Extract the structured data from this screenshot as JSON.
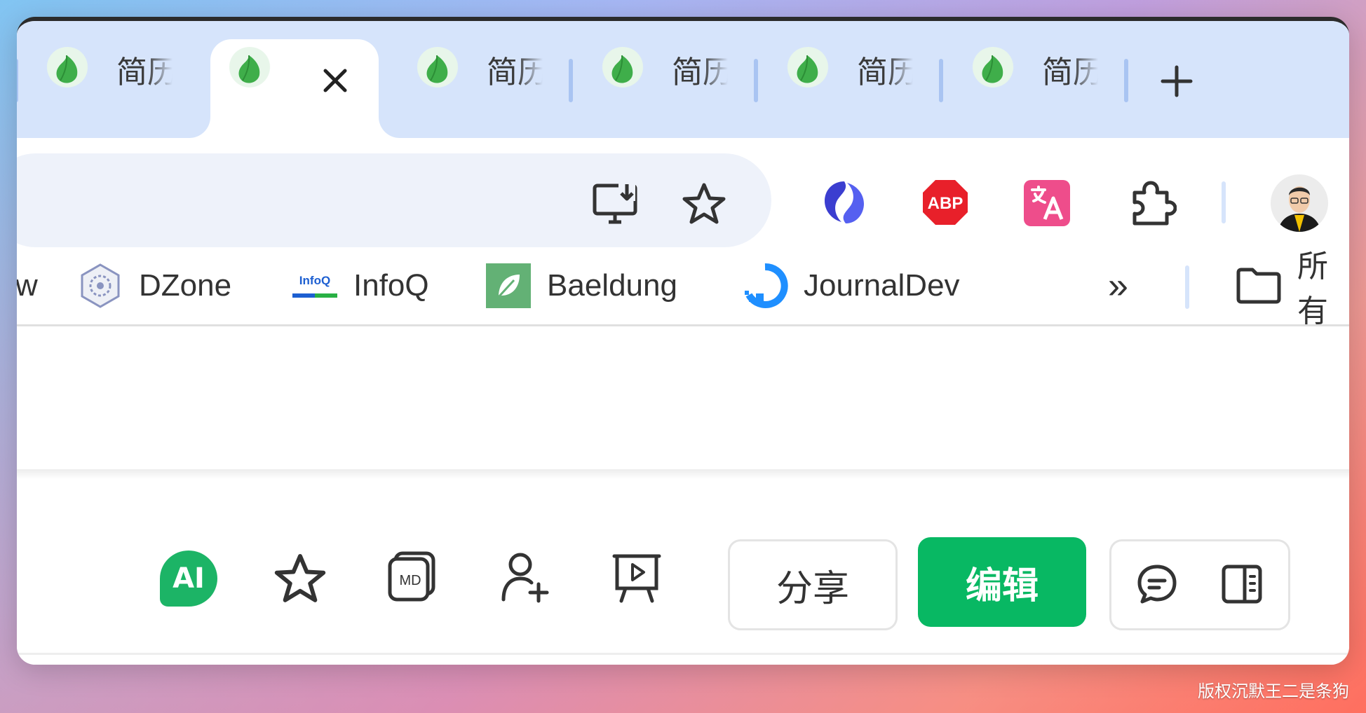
{
  "tabs": [
    {
      "title": "简历"
    },
    {
      "title": ""
    },
    {
      "title": "简历"
    },
    {
      "title": "简历"
    },
    {
      "title": "简历"
    },
    {
      "title": "简历"
    }
  ],
  "active_tab": {
    "close_icon": "close-icon"
  },
  "toolbar": {
    "icons": [
      "install-app-icon",
      "star-icon",
      "sider-extension-icon",
      "adblock-plus-icon",
      "translate-extension-icon",
      "extensions-puzzle-icon",
      "profile-avatar"
    ],
    "abp_text": "ABP"
  },
  "bookmarks": [
    {
      "label": "w"
    },
    {
      "label": "DZone"
    },
    {
      "label": "InfoQ",
      "logo_text": "InfoQ"
    },
    {
      "label": "Baeldung"
    },
    {
      "label": "JournalDev"
    }
  ],
  "bookmarks_more": "»",
  "bookmarks_folder": "所有",
  "bottom": {
    "ai_label": "AI",
    "md_label": "MD",
    "share_label": "分享",
    "edit_label": "编辑"
  },
  "watermark": "版权沉默王二是条狗",
  "colors": {
    "accent": "#08b863",
    "tabstrip": "#d6e4fb",
    "abp": "#e8202a",
    "translate": "#ee4d8b"
  }
}
